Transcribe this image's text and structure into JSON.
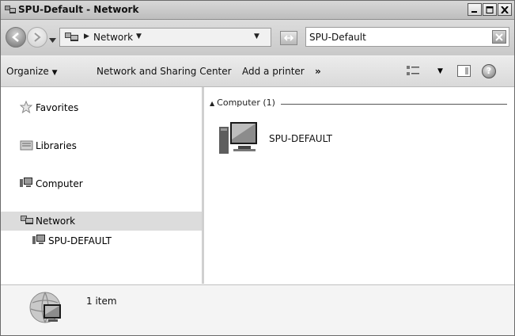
{
  "window": {
    "title": "SPU-Default - Network",
    "controls": {
      "minimize": "_",
      "maximize": "□",
      "close": "X"
    }
  },
  "address_bar": {
    "breadcrumb": "Network",
    "search_value": "SPU-Default"
  },
  "toolbar": {
    "organize_label": "Organize",
    "network_sharing_label": "Network and Sharing Center",
    "add_printer_label": "Add a printer",
    "more_label": "»"
  },
  "nav": {
    "favorites": "Favorites",
    "libraries": "Libraries",
    "computer": "Computer",
    "network": "Network",
    "spu_default": "SPU-DEFAULT"
  },
  "content": {
    "group_header": "Computer (1)",
    "items": [
      {
        "label": "SPU-DEFAULT",
        "icon": "computer-icon"
      }
    ]
  },
  "details": {
    "count_text": "1 item"
  },
  "colors": {
    "selected_bg": "#dcdcdc",
    "toolbar_bg": "#e2e2e2",
    "titlebar_bg": "#c8c8c8"
  }
}
